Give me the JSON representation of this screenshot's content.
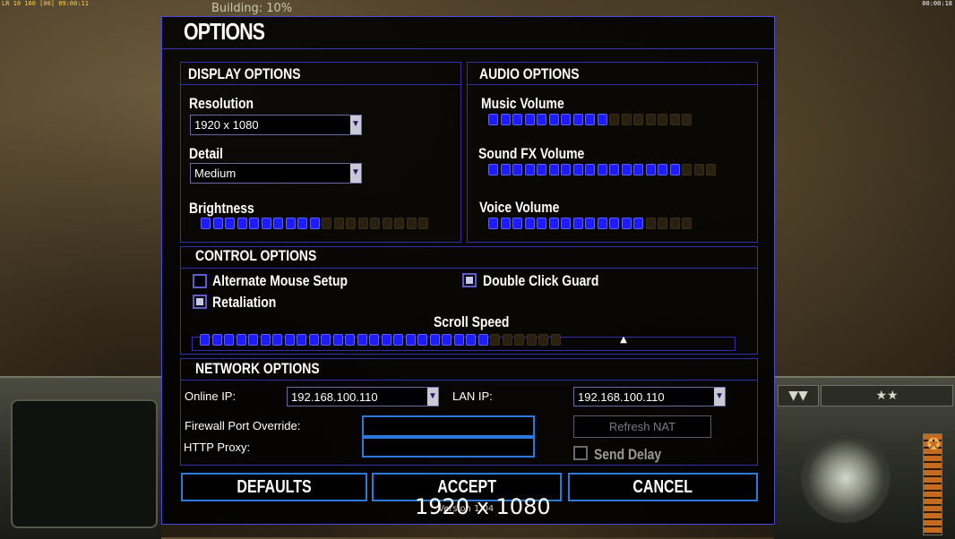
{
  "hud": {
    "top_left": "LR 10 100 [00] 09:00:11",
    "top_right": "00:00:18",
    "building": "Building: 10%",
    "buttons": [
      "▼▼",
      "★★"
    ]
  },
  "dialog": {
    "title": "OPTIONS",
    "display": {
      "header": "DISPLAY OPTIONS",
      "resolution_label": "Resolution",
      "resolution_value": "1920 x 1080",
      "detail_label": "Detail",
      "detail_value": "Medium",
      "brightness_label": "Brightness",
      "brightness_level": 0.54
    },
    "audio": {
      "header": "AUDIO OPTIONS",
      "music_label": "Music Volume",
      "music_level": 0.59,
      "sfx_label": "Sound FX Volume",
      "sfx_level": 0.86,
      "voice_label": "Voice Volume",
      "voice_level": 0.76
    },
    "control": {
      "header": "CONTROL OPTIONS",
      "alt_mouse_label": "Alternate Mouse Setup",
      "alt_mouse_checked": false,
      "retaliation_label": "Retaliation",
      "retaliation_checked": true,
      "double_click_label": "Double Click Guard",
      "double_click_checked": true,
      "scroll_speed_label": "Scroll Speed",
      "scroll_speed_level": 0.8
    },
    "network": {
      "header": "NETWORK OPTIONS",
      "online_ip_label": "Online IP:",
      "online_ip_value": "192.168.100.110",
      "lan_ip_label": "LAN IP:",
      "lan_ip_value": "192.168.100.110",
      "firewall_label": "Firewall Port Override:",
      "firewall_value": "",
      "proxy_label": "HTTP Proxy:",
      "proxy_value": "",
      "refresh_nat_label": "Refresh NAT",
      "send_delay_label": "Send Delay",
      "send_delay_checked": false
    },
    "buttons": {
      "defaults": "DEFAULTS",
      "accept": "ACCEPT",
      "cancel": "CANCEL"
    },
    "version": "Version 1.04"
  },
  "overlay_resolution": "1920 x 1080",
  "colors": {
    "segment_on": "#1c1cff",
    "segment_off": "#2a2010",
    "border": "#3030a8",
    "button_border": "#2a7adc"
  }
}
